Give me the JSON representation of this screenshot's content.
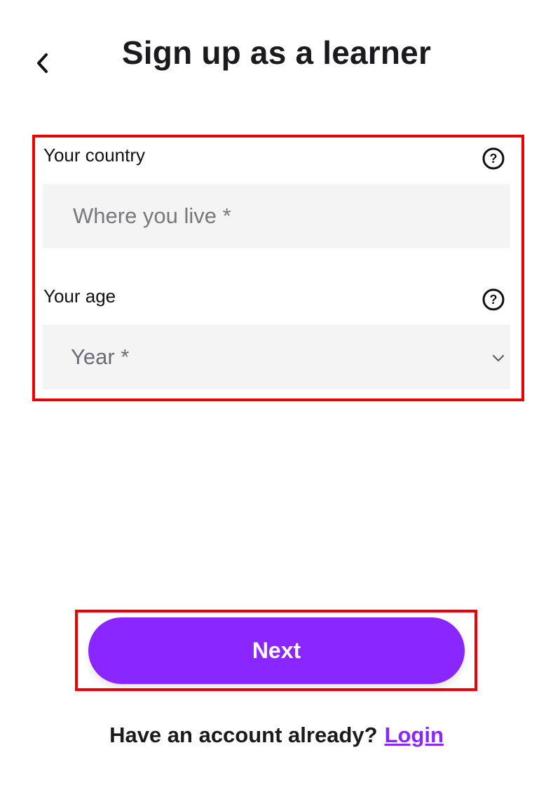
{
  "header": {
    "title": "Sign up as a learner",
    "back_icon": "chevron-left-icon"
  },
  "form": {
    "country": {
      "label": "Your country",
      "placeholder": "Where you live *",
      "value": "",
      "help_icon": "question-circle-icon"
    },
    "age": {
      "label": "Your age",
      "selected": "Year *",
      "help_icon": "question-circle-icon",
      "dropdown_icon": "chevron-down-icon"
    }
  },
  "actions": {
    "next_label": "Next"
  },
  "footer": {
    "prompt": "Have an account already?",
    "login_label": "Login"
  },
  "colors": {
    "accent": "#8a26ff",
    "input_bg": "#f4f4f4",
    "highlight": "#ee0000",
    "text": "#1b1b1f"
  }
}
